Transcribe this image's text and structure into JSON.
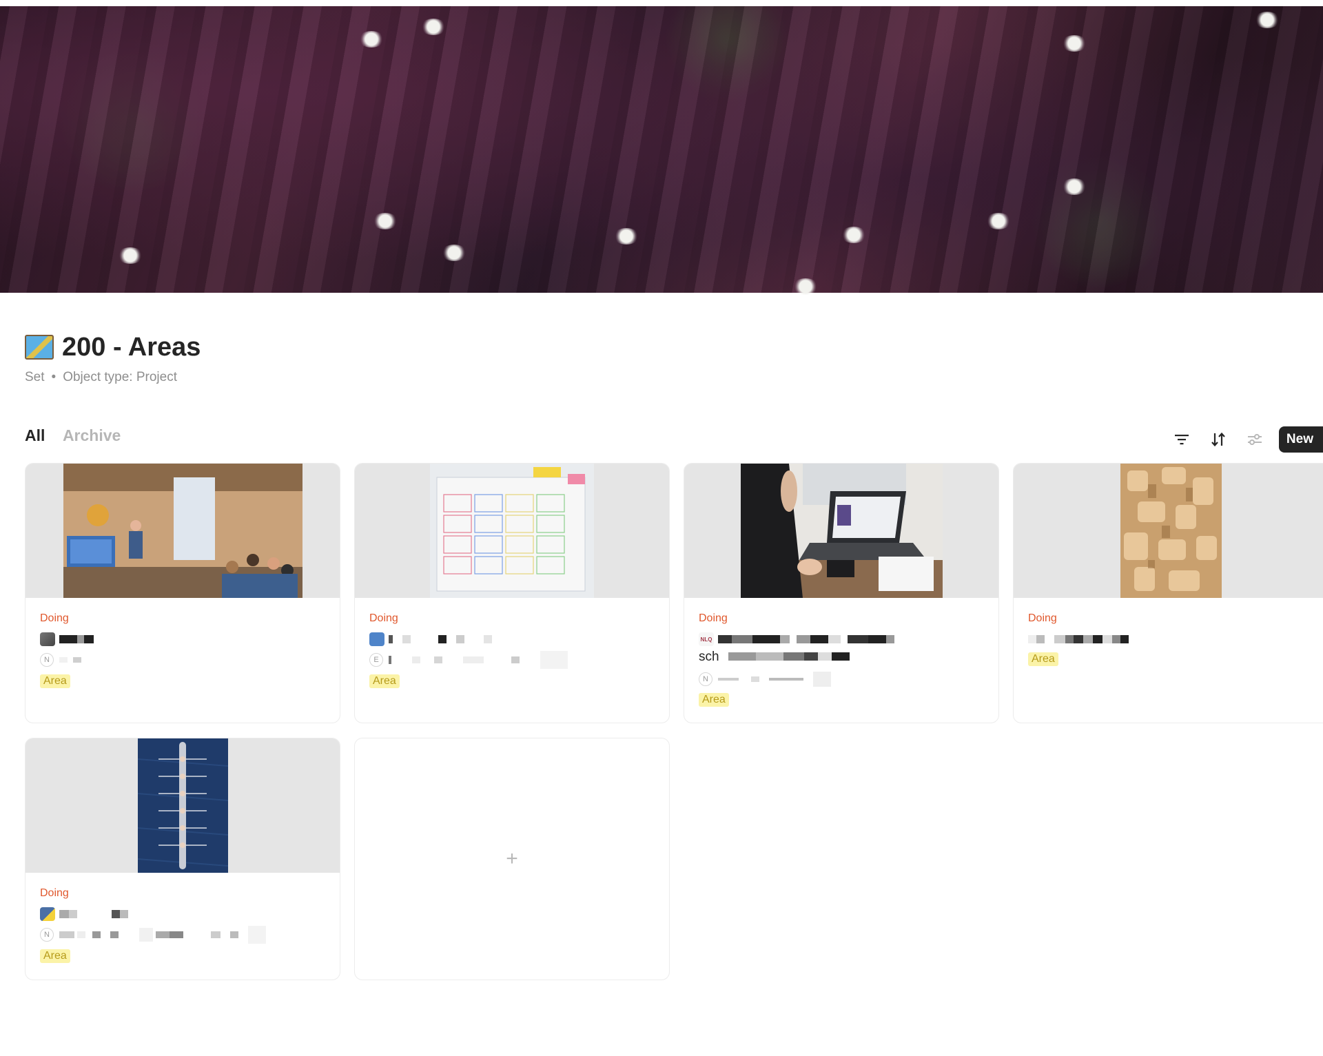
{
  "page": {
    "title": "200 - Areas",
    "meta_kind": "Set",
    "meta_separator": "•",
    "meta_object_type": "Object type: Project",
    "icon": "world-map-icon"
  },
  "views": {
    "all": "All",
    "archive": "Archive"
  },
  "toolbar": {
    "filter_icon": "filter-icon",
    "sort_icon": "sort-icon",
    "settings_icon": "sliders-icon",
    "new_label": "New"
  },
  "cards": [
    {
      "status": "Doing",
      "sub_letter": "N",
      "tag": "Area",
      "image": "office-presentation-photo"
    },
    {
      "status": "Doing",
      "sub_letter": "E",
      "tag": "Area",
      "image": "planning-board-photo"
    },
    {
      "status": "Doing",
      "partial_text": "sch",
      "sub_letter": "N",
      "tag": "Area",
      "image": "laptop-work-photo"
    },
    {
      "status": "Doing",
      "tag": "Area",
      "image": "wooden-blocks-photo"
    },
    {
      "status": "Doing",
      "sub_letter": "N",
      "tag": "Area",
      "image": "rowing-boat-photo"
    }
  ],
  "add_card": {
    "plus": "+"
  },
  "colors": {
    "status": "#e0572c",
    "tag_bg": "#fbf3a8",
    "tag_text": "#b69b1a",
    "new_button_bg": "#252525"
  }
}
